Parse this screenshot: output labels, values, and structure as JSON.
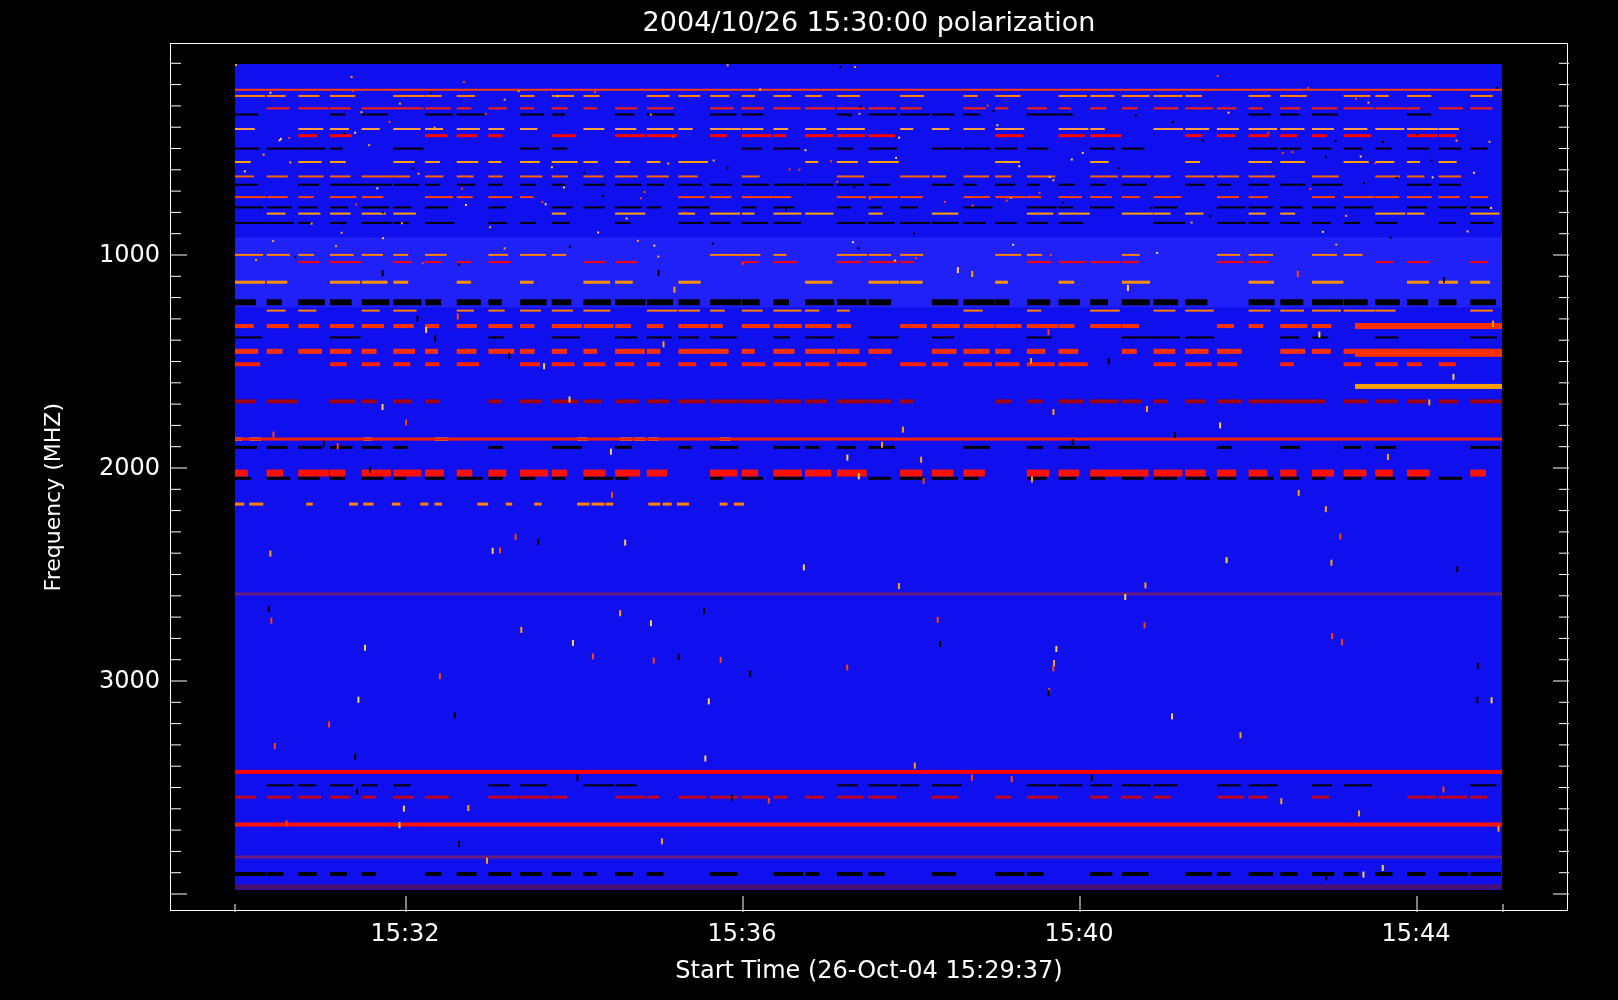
{
  "title": "2004/10/26 15:30:00 polarization",
  "y_axis": {
    "label": "Frequency (MHZ)",
    "ticks": [
      "1000",
      "2000",
      "3000"
    ]
  },
  "x_axis": {
    "label": "Start Time (26-Oct-04 15:29:37)",
    "ticks": [
      "15:32",
      "15:36",
      "15:40",
      "15:44"
    ]
  }
}
